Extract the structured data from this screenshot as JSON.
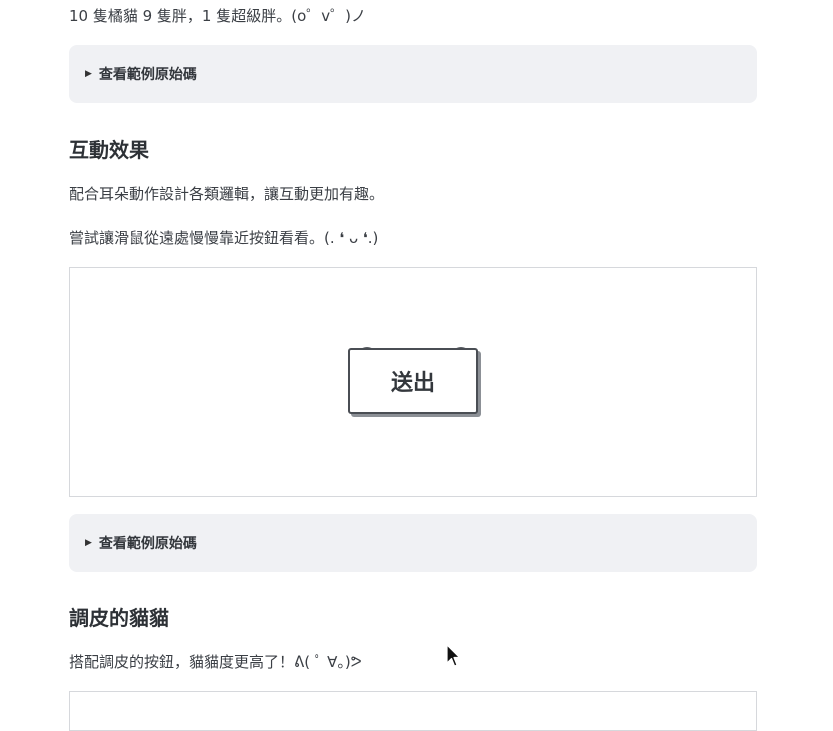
{
  "intro_line": "10 隻橘貓 9 隻胖，1 隻超級胖。(o゜v゜)ノ",
  "details_1": {
    "label": "查看範例原始碼"
  },
  "section_interactive": {
    "title": "互動效果",
    "desc": "配合耳朵動作設計各類邏輯，讓互動更加有趣。",
    "hint": "嘗試讓滑鼠從遠處慢慢靠近按鈕看看。(. ❛ ᴗ ❛.)"
  },
  "demo": {
    "button_label": "送出"
  },
  "details_2": {
    "label": "查看範例原始碼"
  },
  "section_naughty": {
    "title": "調皮的貓貓",
    "desc": "搭配調皮的按鈕，貓貓度更高了！ᕕ( ﾟ ∀。)ᕗ"
  },
  "icons": {
    "expand": "triangle-right-icon",
    "cursor": "mouse-pointer-icon"
  }
}
